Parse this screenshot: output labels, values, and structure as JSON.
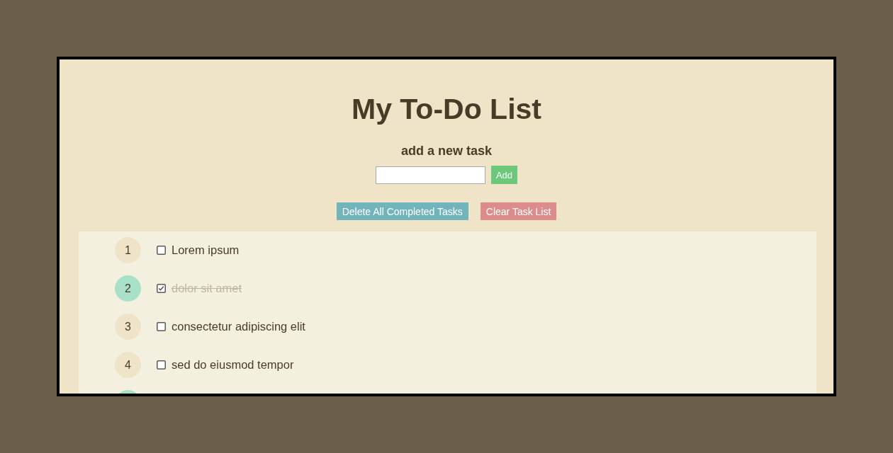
{
  "title": "My To-Do List",
  "new_task": {
    "heading": "add a new task",
    "add_button": "Add"
  },
  "actions": [
    {
      "label": "Delete All Completed Tasks",
      "kind": "delete"
    },
    {
      "label": "Clear Task List",
      "kind": "clear"
    }
  ],
  "tasks": [
    {
      "number": "1",
      "label": "Lorem ipsum",
      "checked": false
    },
    {
      "number": "2",
      "label": "dolor sit amet",
      "checked": true
    },
    {
      "number": "3",
      "label": "consectetur adipiscing elit",
      "checked": false
    },
    {
      "number": "4",
      "label": "sed do eiusmod tempor",
      "checked": false
    },
    {
      "checked": true
    }
  ]
}
